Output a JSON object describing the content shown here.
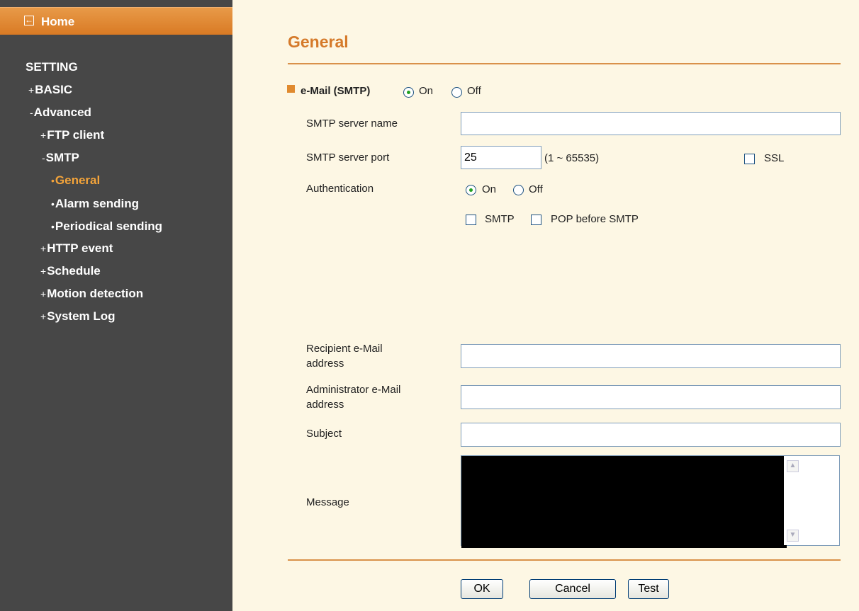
{
  "sidebar": {
    "home_label": "Home",
    "section_title": "SETTING",
    "items": [
      {
        "prefix": "+",
        "label": "BASIC"
      },
      {
        "prefix": "-",
        "label": "Advanced"
      },
      {
        "prefix": "+",
        "label": "FTP client"
      },
      {
        "prefix": "-",
        "label": "SMTP"
      },
      {
        "prefix": "•",
        "label": "General"
      },
      {
        "prefix": "•",
        "label": "Alarm sending"
      },
      {
        "prefix": "•",
        "label": "Periodical sending"
      },
      {
        "prefix": "+",
        "label": "HTTP event"
      },
      {
        "prefix": "+",
        "label": "Schedule"
      },
      {
        "prefix": "+",
        "label": "Motion detection"
      },
      {
        "prefix": "+",
        "label": "System Log"
      }
    ],
    "active_item": "General"
  },
  "main": {
    "title": "General",
    "email": {
      "label": "e-Mail (SMTP)",
      "on": "On",
      "off": "Off",
      "selected": "On"
    },
    "smtp_server_name": {
      "label": "SMTP server name",
      "value": ""
    },
    "smtp_server_port": {
      "label": "SMTP server port",
      "value": "25",
      "range": "(1 ~ 65535)"
    },
    "ssl": {
      "label": "SSL",
      "checked": false
    },
    "authentication": {
      "label": "Authentication",
      "on": "On",
      "off": "Off",
      "selected": "On"
    },
    "auth_methods": {
      "smtp": "SMTP",
      "pop": "POP before SMTP"
    },
    "recipient": {
      "label_line1": "Recipient e-Mail",
      "label_line2": "address",
      "value": ""
    },
    "administrator": {
      "label_line1": "Administrator e-Mail",
      "label_line2": "address",
      "value": ""
    },
    "subject": {
      "label": "Subject",
      "value": ""
    },
    "message": {
      "label": "Message",
      "value": ""
    },
    "buttons": {
      "ok": "OK",
      "cancel": "Cancel",
      "test": "Test"
    }
  },
  "colors": {
    "accent": "#d57a2a",
    "sidebar_bg": "#474747",
    "page_bg": "#fdf7e4",
    "active_nav": "#f4a43a"
  }
}
